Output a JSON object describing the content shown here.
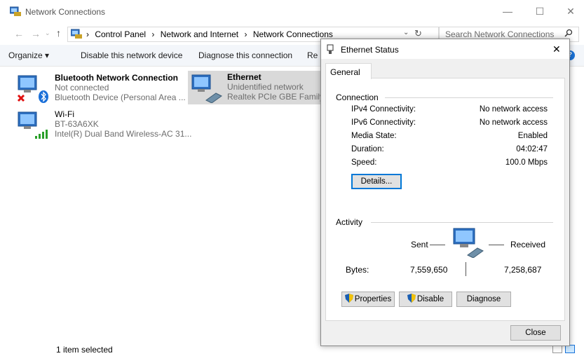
{
  "window": {
    "title": "Network Connections",
    "controls": {
      "minimize": "—",
      "maximize": "☐",
      "close": "✕"
    }
  },
  "address_bar": {
    "breadcrumbs": [
      "Control Panel",
      "Network and Internet",
      "Network Connections"
    ],
    "separator": "›",
    "search_placeholder": "Search Network Connections"
  },
  "command_bar": {
    "organize": "Organize ▾",
    "disable": "Disable this network device",
    "diagnose": "Diagnose this connection",
    "rename_partial": "Re"
  },
  "connections": [
    {
      "name": "Bluetooth Network Connection",
      "status": "Not connected",
      "device": "Bluetooth Device (Personal Area ..."
    },
    {
      "name": "Wi-Fi",
      "status": "BT-63A6XK",
      "device": "Intel(R) Dual Band Wireless-AC 31..."
    },
    {
      "name": "Ethernet",
      "status": "Unidentified network",
      "device": "Realtek PCIe GBE Family C"
    }
  ],
  "status_bar": {
    "text": "1 item selected"
  },
  "dialog": {
    "title": "Ethernet Status",
    "close": "✕",
    "tab": "General",
    "connection": {
      "header": "Connection",
      "rows": [
        {
          "label": "IPv4 Connectivity:",
          "value": "No network access"
        },
        {
          "label": "IPv6 Connectivity:",
          "value": "No network access"
        },
        {
          "label": "Media State:",
          "value": "Enabled"
        },
        {
          "label": "Duration:",
          "value": "04:02:47"
        },
        {
          "label": "Speed:",
          "value": "100.0 Mbps"
        }
      ],
      "details_button": "Details..."
    },
    "activity": {
      "header": "Activity",
      "sent_label": "Sent",
      "received_label": "Received",
      "bytes_label": "Bytes:",
      "bytes_sent": "7,559,650",
      "bytes_received": "7,258,687"
    },
    "buttons": {
      "properties": "Properties",
      "disable": "Disable",
      "diagnose": "Diagnose",
      "close": "Close"
    }
  },
  "colors": {
    "accent": "#0078d7",
    "selection": "#cce8ff",
    "cmd_bar": "#f3f6fa",
    "dialog_bg": "#f0f0f0"
  }
}
